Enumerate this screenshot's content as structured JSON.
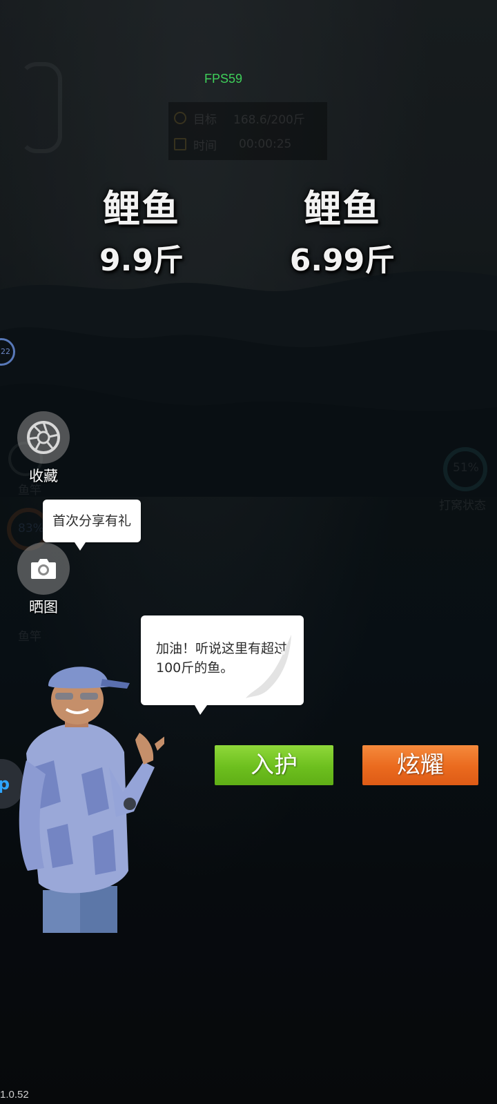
{
  "hud": {
    "fps": "FPS59",
    "target_label": "目标",
    "target_value": "168.6/200斤",
    "time_label": "时间",
    "time_value": "00:00:25"
  },
  "catches": [
    {
      "name": "鲤鱼",
      "weight": "9.9斤"
    },
    {
      "name": "鲤鱼",
      "weight": "6.99斤"
    }
  ],
  "badge_number": "22",
  "side_buttons": {
    "collect_label": "收藏",
    "screenshot_label": "晒图"
  },
  "background_hud": {
    "left_label_1": "鱼竿",
    "left_percent": "83%",
    "left_label_2": "鱼竿",
    "right_percent": "51%",
    "right_label": "打窝状态"
  },
  "tooltips": {
    "share_tip": "首次分享有礼",
    "host_speech": "加油！听说这里有超过100斤的鱼。"
  },
  "actions": {
    "keep_label": "入护",
    "show_off_label": "炫耀"
  },
  "app_tab_label": "ap",
  "version": "1.0.52",
  "colors": {
    "fps_green": "#3fd05a",
    "keep_green": "#6dbf1e",
    "show_orange": "#ea6a1e"
  },
  "icons": {
    "collect": "aperture-icon",
    "screenshot": "camera-icon"
  }
}
